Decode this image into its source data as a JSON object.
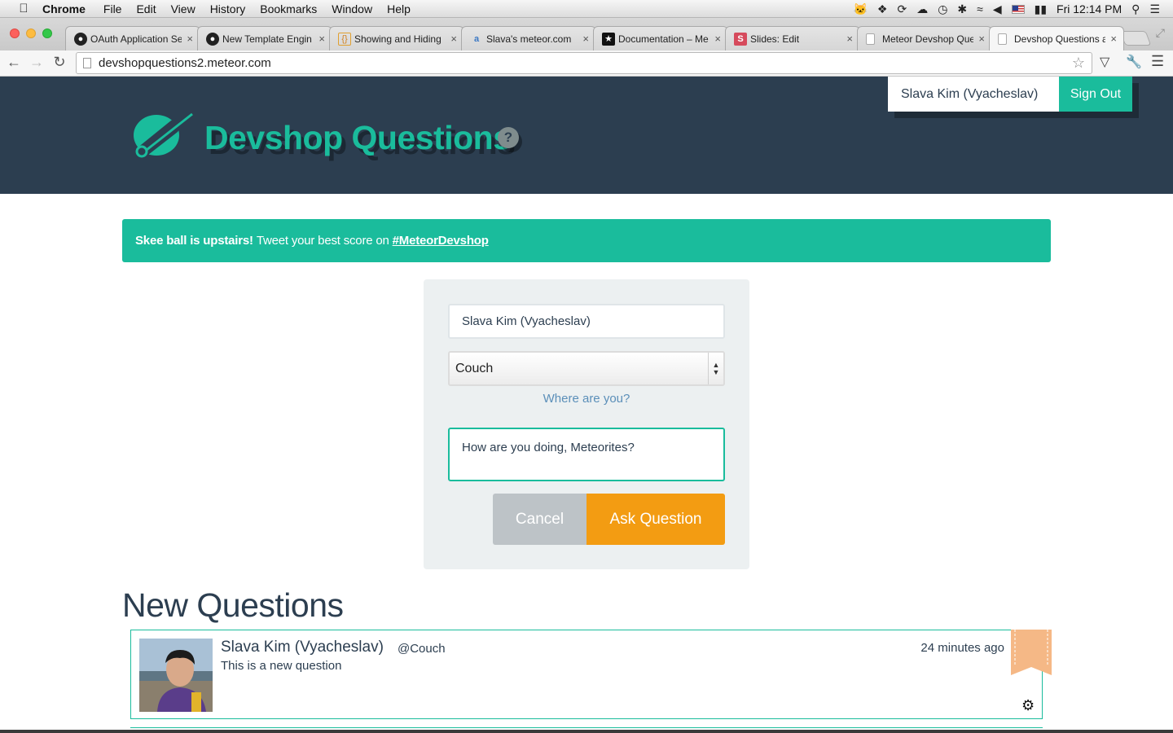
{
  "menubar": {
    "app": "Chrome",
    "items": [
      "File",
      "Edit",
      "View",
      "History",
      "Bookmarks",
      "Window",
      "Help"
    ],
    "clock": "Fri 12:14 PM"
  },
  "tabs": [
    {
      "label": "OAuth Application Se",
      "icon": "github-icon"
    },
    {
      "label": "New Template Engin",
      "icon": "github-icon"
    },
    {
      "label": "Showing and Hiding",
      "icon": "braces-icon"
    },
    {
      "label": "Slava's meteor.com",
      "icon": "page-icon"
    },
    {
      "label": "Documentation – Me",
      "icon": "meteor-icon"
    },
    {
      "label": "Slides: Edit",
      "icon": "slides-icon"
    },
    {
      "label": "Meteor Devshop Que",
      "icon": "page-icon"
    },
    {
      "label": "Devshop Questions a",
      "icon": "page-icon"
    }
  ],
  "address_bar": {
    "url": "devshopquestions2.meteor.com"
  },
  "header": {
    "title": "Devshop Questions",
    "help": "?",
    "user_name": "Slava Kim (Vyacheslav)",
    "sign_out_label": "Sign Out"
  },
  "alert": {
    "bold": "Skee ball is upstairs!",
    "text": "Tweet your best score on",
    "link": "#MeteorDevshop"
  },
  "form": {
    "name_value": "Slava Kim (Vyacheslav)",
    "location_value": "Couch",
    "where_link": "Where are you?",
    "question_value": "How are you doing, Meteorites?",
    "cancel_label": "Cancel",
    "ask_label": "Ask Question"
  },
  "questions": {
    "heading": "New Questions",
    "items": [
      {
        "author": "Slava Kim (Vyacheslav)",
        "location": "@Couch",
        "text": "This is a new question",
        "time": "24 minutes ago"
      }
    ]
  },
  "colors": {
    "header_bg": "#2c3e50",
    "accent": "#1abc9c",
    "ask_button": "#f39c12",
    "cancel_button": "#bdc3c7",
    "bookmark": "#f5b886"
  }
}
